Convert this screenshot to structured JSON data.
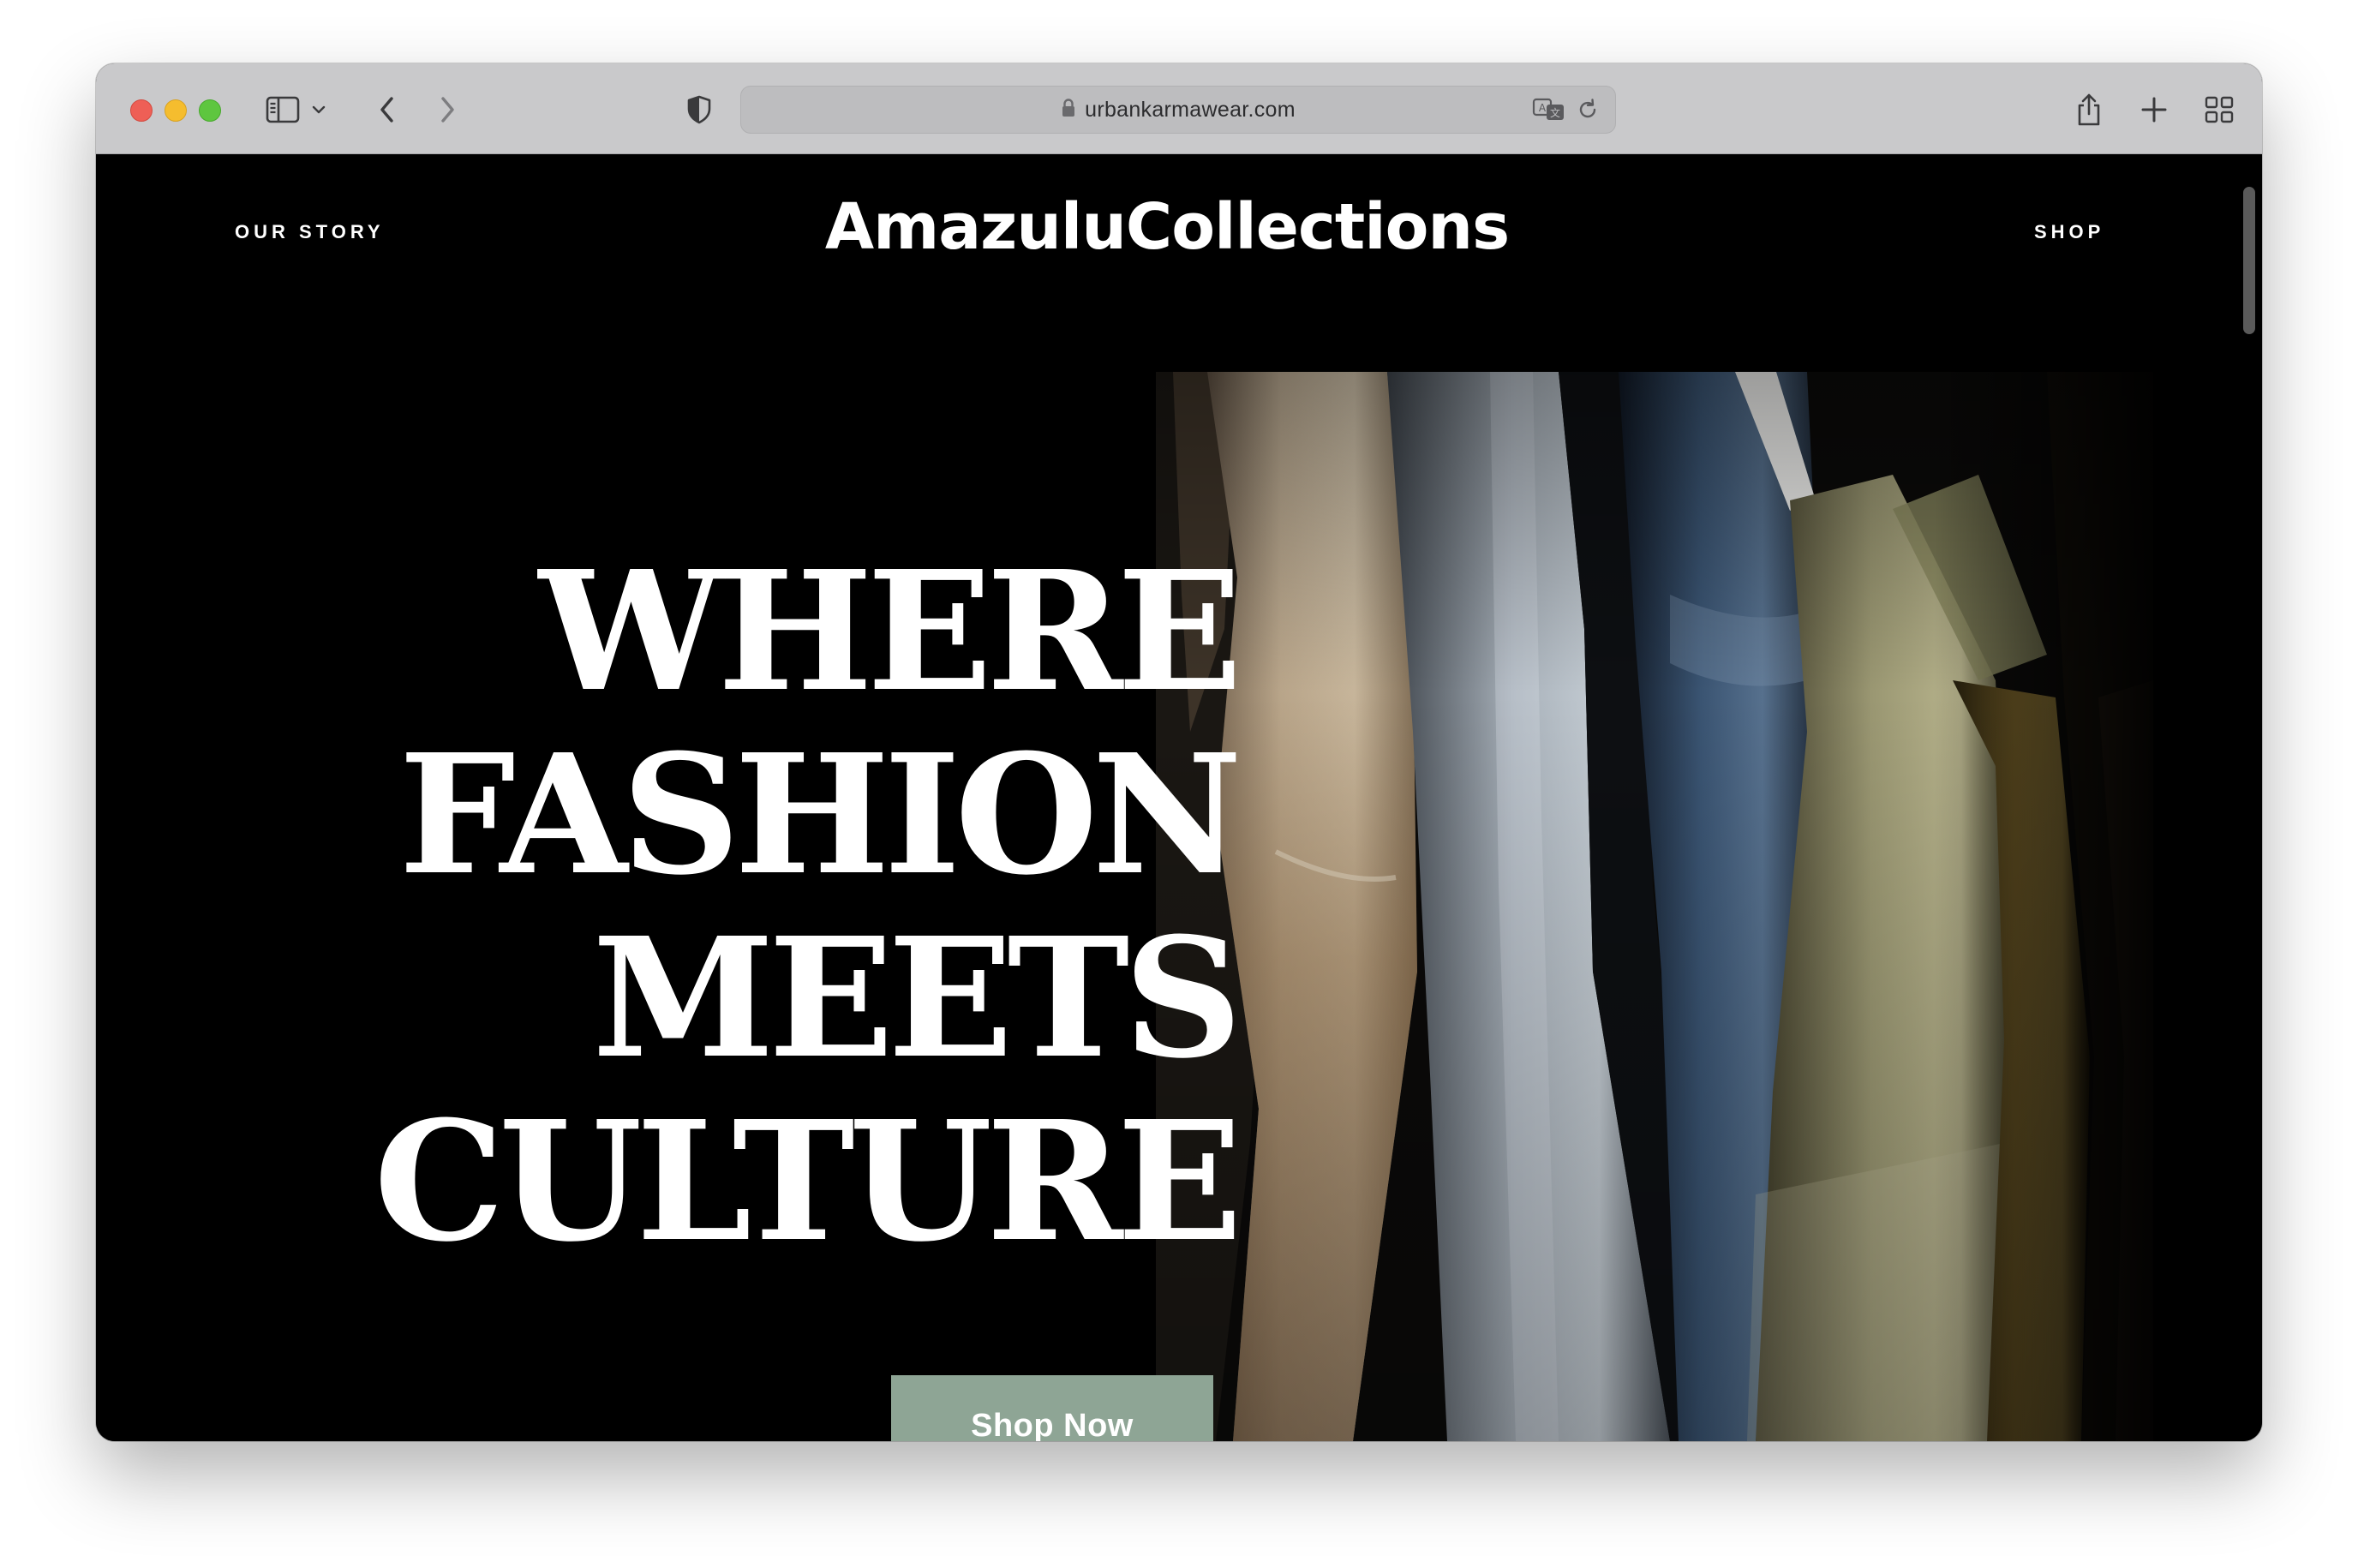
{
  "browser": {
    "url": "urbankarmawear.com",
    "icons": {
      "close": "close-dot",
      "minimize": "minimize-dot",
      "maximize": "maximize-dot",
      "sidebar": "sidebar-icon",
      "sidebar_menu": "chevron-down-icon",
      "back": "chevron-left-icon",
      "forward": "chevron-right-icon",
      "privacy": "shield-icon",
      "lock": "lock-icon",
      "translate": "translate-icon",
      "reload": "reload-icon",
      "share": "share-icon",
      "new_tab": "plus-icon",
      "tab_overview": "grid-icon"
    },
    "colors": {
      "toolbar": "#c9c9cb",
      "close": "#ee5f56",
      "minimize": "#f5bd2e",
      "maximize": "#5ec63f"
    }
  },
  "site": {
    "nav": {
      "left": "OUR STORY",
      "right": "SHOP"
    },
    "brand": "AmazuluCollections",
    "hero": {
      "headline": [
        "WHERE",
        "FASHION",
        "MEETS",
        "CULTURE"
      ],
      "cta": "Shop Now",
      "image": "clothes-hanging-on-rack-photo"
    },
    "colors": {
      "background": "#000000",
      "text": "#ffffff",
      "cta_background": "#8ea595"
    }
  }
}
